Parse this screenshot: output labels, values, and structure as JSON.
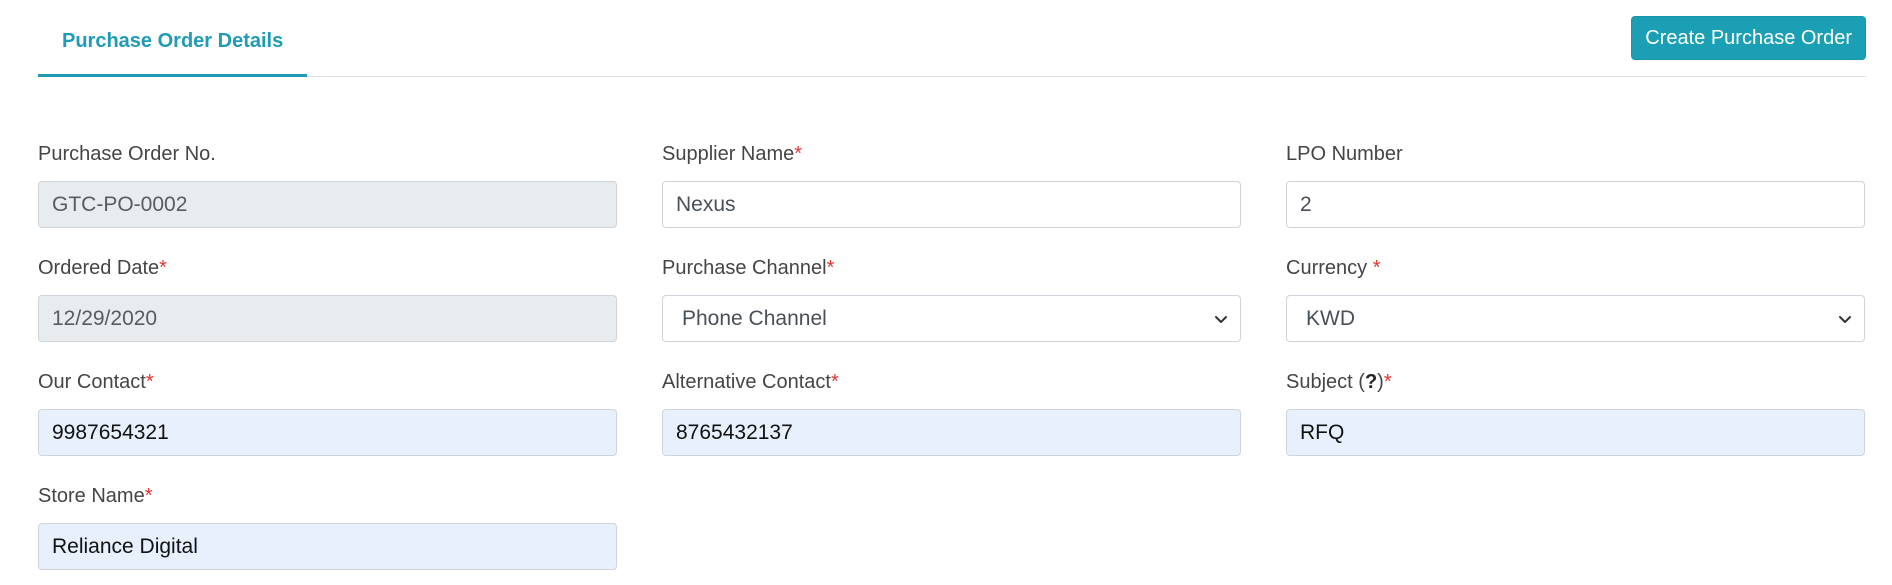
{
  "header": {
    "active_tab": "Purchase Order Details",
    "create_button": "Create Purchase Order"
  },
  "form": {
    "purchase_order_no": {
      "label": "Purchase Order No.",
      "value": "GTC-PO-0002"
    },
    "supplier_name": {
      "label": "Supplier Name",
      "required": "*",
      "value": "Nexus"
    },
    "lpo_number": {
      "label": "LPO Number",
      "value": "2"
    },
    "ordered_date": {
      "label": "Ordered Date",
      "required": "*",
      "value": "12/29/2020"
    },
    "purchase_channel": {
      "label": "Purchase Channel",
      "required": "*",
      "value": "Phone Channel"
    },
    "currency": {
      "label": "Currency ",
      "required": "*",
      "value": "KWD"
    },
    "our_contact": {
      "label": "Our Contact",
      "required": "*",
      "value": "9987654321"
    },
    "alternative_contact": {
      "label": "Alternative Contact",
      "required": "*",
      "value": "8765432137"
    },
    "subject": {
      "label": "Subject (",
      "help": "?",
      "label_end": ")",
      "required": "*",
      "value": "RFQ"
    },
    "store_name": {
      "label": "Store Name",
      "required": "*",
      "value": "Reliance Digital"
    }
  },
  "colors": {
    "accent": "#1f9bb6",
    "button_bg": "#1a9fb4",
    "required": "#e3342f",
    "readonly_bg": "#e9ecef",
    "autofill_bg": "#e8f0fe"
  },
  "icons": {
    "select_arrow": "chevron-down-icon"
  }
}
